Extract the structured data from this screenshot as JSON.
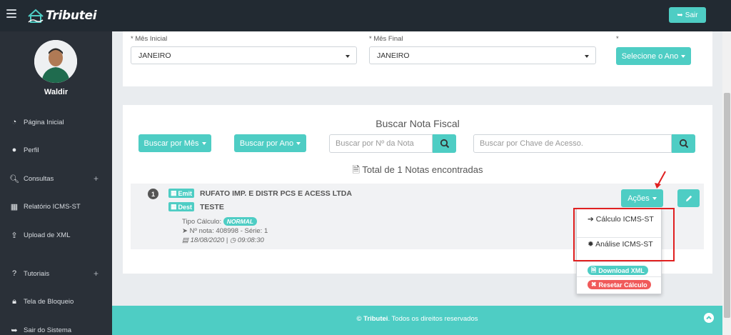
{
  "app": {
    "name": "Tributei"
  },
  "header": {
    "logout_label": "Sair"
  },
  "user": {
    "name": "Waldir"
  },
  "sidebar": {
    "items": [
      {
        "label": "Página Inicial",
        "icon": "dashboard-icon"
      },
      {
        "label": "Perfil",
        "icon": "user-icon"
      },
      {
        "label": "Consultas",
        "icon": "search-icon",
        "expand": "+"
      },
      {
        "label": "Relatório ICMS-ST",
        "icon": "calculator-icon"
      },
      {
        "label": "Upload de XML",
        "icon": "upload-icon"
      },
      {
        "label": "Tutoriais",
        "icon": "question-icon",
        "expand": "+"
      },
      {
        "label": "Tela de Bloqueio",
        "icon": "lock-icon"
      },
      {
        "label": "Sair do Sistema",
        "icon": "sign-out-icon"
      }
    ]
  },
  "filters": {
    "mes_inicial": {
      "label": "* Mês Inicial",
      "value": "JANEIRO"
    },
    "mes_final": {
      "label": "* Mês Final",
      "value": "JANEIRO"
    },
    "ano": {
      "label": "*",
      "button": "Selecione o Ano"
    }
  },
  "search": {
    "title": "Buscar Nota Fiscal",
    "by_month": "Buscar por Mês",
    "by_year": "Buscar por Ano",
    "number_placeholder": "Buscar por Nº da Nota",
    "key_placeholder": "Buscar por Chave de Acesso.",
    "total": "Total de 1 Notas encontradas"
  },
  "results": [
    {
      "index": "1",
      "emit_label": "Emit",
      "emitente": "RUFATO IMP. E DISTR PCS E ACESS LTDA",
      "dest_label": "Dest",
      "destinatario": "TESTE",
      "tipo_calculo_label": "Tipo Cálculo:",
      "tipo_calculo": "NORMAL",
      "nota_info": "Nº nota: 408998 - Série: 1",
      "date": "18/08/2020",
      "time": "09:08:30",
      "actions_label": "Ações"
    }
  ],
  "actions_menu": {
    "calculo": "Cálculo ICMS-ST",
    "analise": "Análise ICMS-ST",
    "download": "Download XML",
    "reset": "Resetar Cálculo"
  },
  "footer": {
    "brand": "© Tributei",
    "text": ". Todos os direitos reservados"
  },
  "colors": {
    "accent": "#4ecdc4",
    "topbar": "#222a32",
    "sidebar": "#2a3038",
    "danger": "#f05a5a",
    "highlight": "#e02020"
  }
}
